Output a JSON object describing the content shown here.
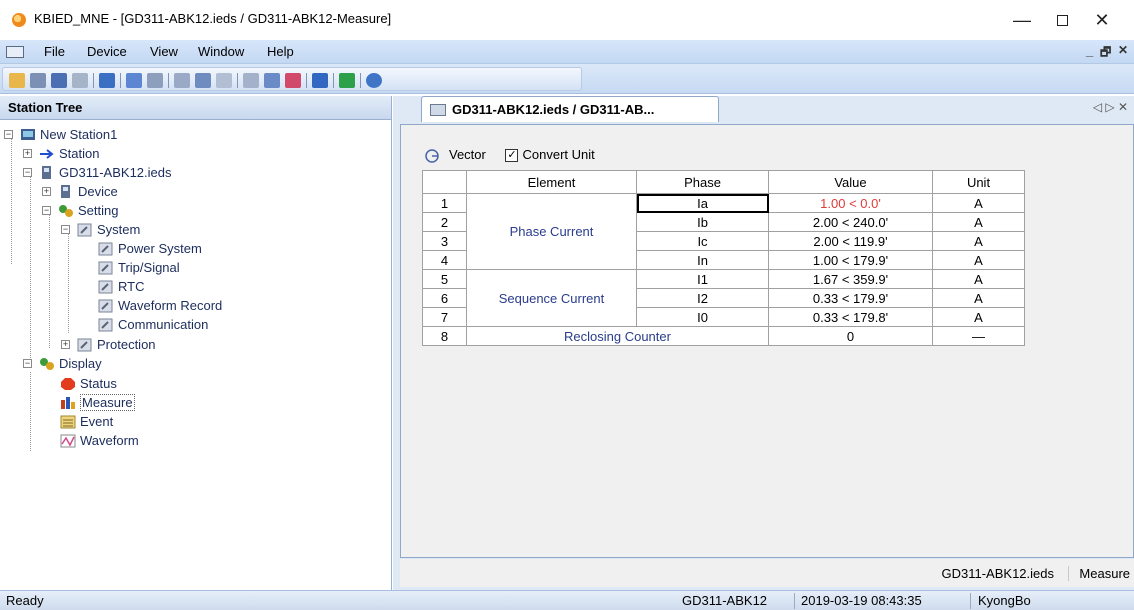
{
  "window": {
    "title": "KBIED_MNE - [GD311-ABK12.ieds / GD311-ABK12-Measure]",
    "minimize": "—",
    "close": "✕"
  },
  "menu": {
    "items": [
      "File",
      "Device",
      "View",
      "Window",
      "Help"
    ],
    "mdi_min": "_",
    "mdi_restore": "🗗",
    "mdi_close": "✕"
  },
  "toolbar": {
    "icons": [
      "open-icon",
      "save-icon",
      "connect-icon",
      "network-icon",
      "tree-icon",
      "send-icon",
      "receive-icon",
      "settings-icon",
      "monitor-icon",
      "grid-icon",
      "panel-icon",
      "waveform-icon",
      "compare-icon",
      "export-icon",
      "delete-icon",
      "help-icon"
    ]
  },
  "station_tree": {
    "header": "Station Tree",
    "items": [
      {
        "label": "New Station1"
      },
      {
        "label": "Station"
      },
      {
        "label": "GD311-ABK12.ieds"
      },
      {
        "label": "Device"
      },
      {
        "label": "Setting"
      },
      {
        "label": "System"
      },
      {
        "label": "Power System"
      },
      {
        "label": "Trip/Signal"
      },
      {
        "label": "RTC"
      },
      {
        "label": "Waveform Record"
      },
      {
        "label": "Communication"
      },
      {
        "label": "Protection"
      },
      {
        "label": "Display"
      },
      {
        "label": "Status"
      },
      {
        "label": "Measure"
      },
      {
        "label": "Event"
      },
      {
        "label": "Waveform"
      }
    ]
  },
  "document": {
    "tab_label": "GD311-ABK12.ieds / GD311-AB...",
    "tab_nav": "◁ ▷ ✕",
    "vector_label": "Vector",
    "convert_unit_label": "Convert Unit",
    "convert_unit_checked": "✓",
    "table": {
      "headers": [
        "Element",
        "Phase",
        "Value",
        "Unit"
      ],
      "groups": {
        "phase_current": "Phase Current",
        "sequence_current": "Sequence Current",
        "reclosing_counter": "Reclosing Counter"
      },
      "rows": [
        {
          "no": "1",
          "phase": "Ia",
          "value": "1.00 < 0.0'",
          "unit": "A"
        },
        {
          "no": "2",
          "phase": "Ib",
          "value": "2.00 < 240.0'",
          "unit": "A"
        },
        {
          "no": "3",
          "phase": "Ic",
          "value": "2.00 < 119.9'",
          "unit": "A"
        },
        {
          "no": "4",
          "phase": "In",
          "value": "1.00 < 179.9'",
          "unit": "A"
        },
        {
          "no": "5",
          "phase": "I1",
          "value": "1.67 < 359.9'",
          "unit": "A"
        },
        {
          "no": "6",
          "phase": "I2",
          "value": "0.33 < 179.9'",
          "unit": "A"
        },
        {
          "no": "7",
          "phase": "I0",
          "value": "0.33 < 179.8'",
          "unit": "A"
        },
        {
          "no": "8",
          "value": "0",
          "unit": "—"
        }
      ],
      "highlight_color": "#e23b3b"
    },
    "status_file": "GD311-ABK12.ieds",
    "status_view": "Measure"
  },
  "statusbar": {
    "left": "Ready",
    "device": "GD311-ABK12",
    "datetime": "2019-03-19 08:43:35",
    "user": "KyongBo"
  }
}
